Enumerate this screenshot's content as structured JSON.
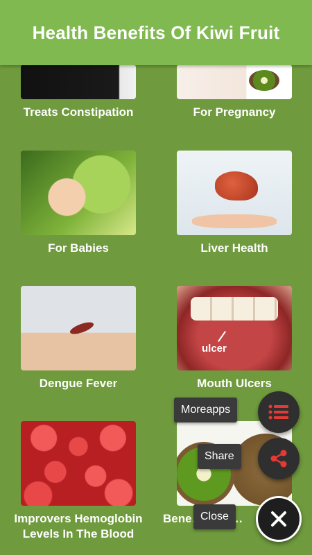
{
  "header": {
    "title": "Health Benefits Of Kiwi Fruit"
  },
  "items": [
    {
      "label": "Treats Constipation"
    },
    {
      "label": "For Pregnancy"
    },
    {
      "label": "For Babies"
    },
    {
      "label": "Liver Health"
    },
    {
      "label": "Dengue Fever"
    },
    {
      "label": "Mouth Ulcers"
    },
    {
      "label": "Improvers Hemoglobin Levels In The Blood"
    },
    {
      "label": "Bene… Kiwi…"
    }
  ],
  "thumb_text": {
    "ulcer": "ulcer"
  },
  "fab_menu": {
    "moreapps_label": "Moreapps",
    "share_label": "Share",
    "close_label": "Close",
    "accent_color": "#e53935"
  }
}
